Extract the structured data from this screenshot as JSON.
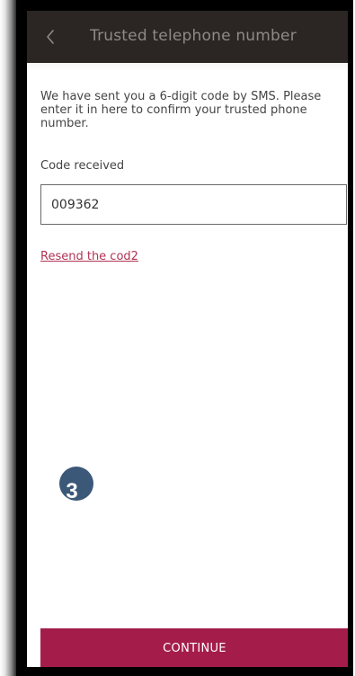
{
  "header": {
    "title": "Trusted telephone number",
    "back_icon": "chevron-left-icon"
  },
  "main": {
    "instructions": "We have sent you a 6-digit code by SMS. Please enter it in here to confirm your trusted phone number.",
    "code_label": "Code received",
    "code_value": "009362",
    "resend_label": "Resend the cod2"
  },
  "annotation": {
    "step_number": "3"
  },
  "footer": {
    "continue_label": "CONTINUE"
  },
  "colors": {
    "header_background": "#2b2624",
    "accent": "#a41d4a",
    "link": "#b03353",
    "badge": "#3c5878"
  }
}
